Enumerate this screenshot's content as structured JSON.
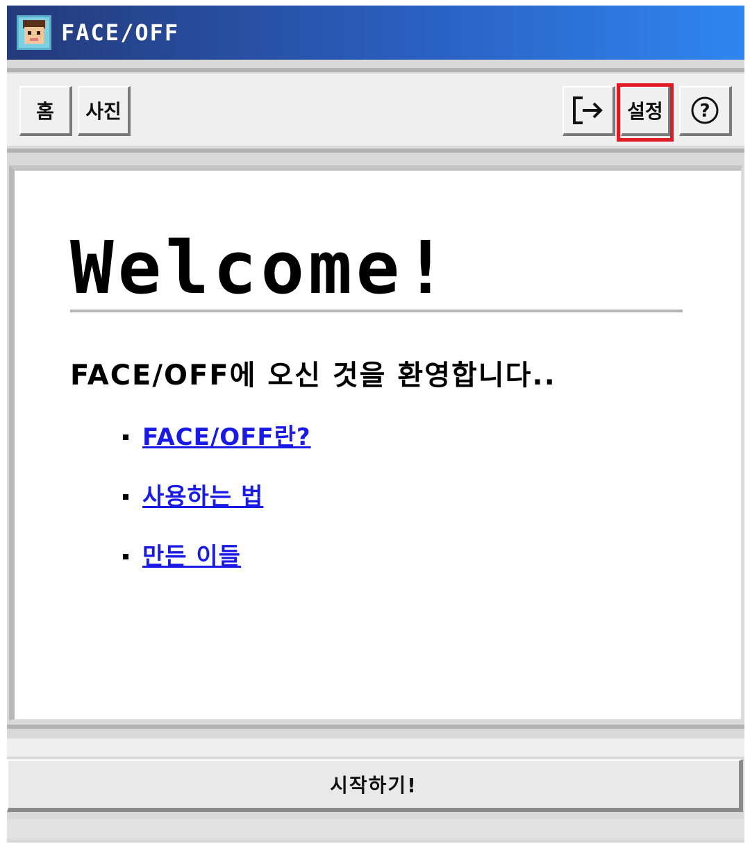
{
  "window": {
    "title": "FACE/OFF",
    "app_icon": "face-avatar-icon"
  },
  "toolbar": {
    "home_label": "홈",
    "photo_label": "사진",
    "logout_icon": "exit-arrow-icon",
    "logout_glyph": "[→",
    "settings_label": "설정",
    "help_icon": "help-circle-icon",
    "help_glyph": "?"
  },
  "main": {
    "heading": "Welcome!",
    "subtitle": "FACE/OFF에 오신 것을 환영합니다..",
    "links": [
      {
        "label": "FACE/OFF란?"
      },
      {
        "label": "사용하는 법"
      },
      {
        "label": "만든 이들"
      }
    ]
  },
  "footer": {
    "start_label": "시작하기!"
  },
  "colors": {
    "highlight": "#e01b24",
    "link": "#1a1ae6",
    "title_start": "#243a7a",
    "title_end": "#2f86f0"
  }
}
